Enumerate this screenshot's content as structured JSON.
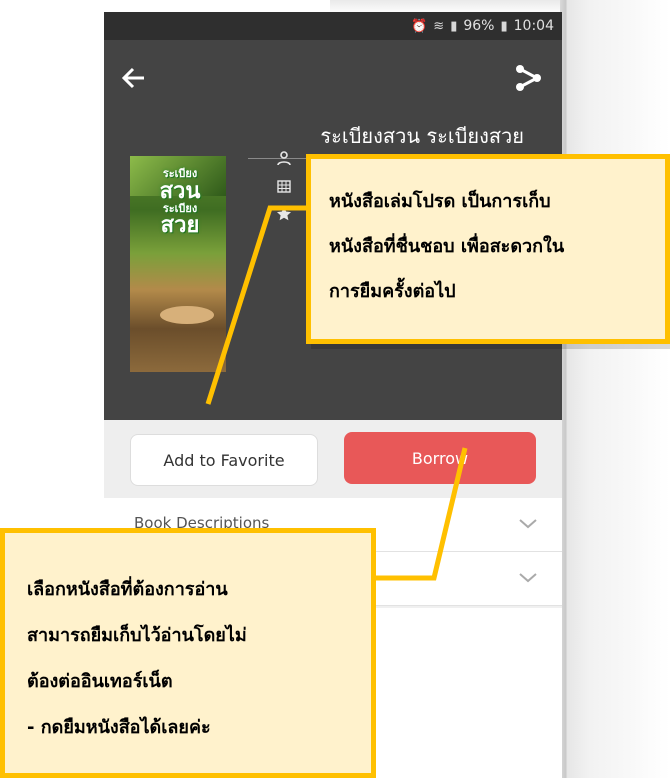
{
  "status_bar": {
    "battery": "96%",
    "time": "10:04"
  },
  "header": {
    "book_title": "ระเบียงสวน ระเบียงสวย"
  },
  "cover": {
    "title_lines": [
      "ระเบียง",
      "สวน",
      "ระเบียง",
      "สวย"
    ]
  },
  "meta_icons": [
    "person-icon",
    "building-icon",
    "star-icon"
  ],
  "actions": {
    "favorite_label": "Add to Favorite",
    "borrow_label": "Borrow"
  },
  "sections": [
    {
      "label": "Book Descriptions"
    },
    {
      "label": ""
    }
  ],
  "callouts": {
    "favorite": [
      "หนังสือเล่มโปรด เป็นการเก็บ",
      "หนังสือที่ชื่นชอบ เพื่อสะดวกใน",
      "การยืมครั้งต่อไป"
    ],
    "borrow": [
      "เลือกหนังสือที่ต้องการอ่าน",
      "สามารถยืมเก็บไว้อ่านโดยไม่",
      "ต้องต่ออินเทอร์เน็ต",
      "- กดยืมหนังสือได้เลยค่ะ"
    ]
  },
  "colors": {
    "header_bg": "#444444",
    "borrow": "#e85858",
    "callout_fill": "#fff2cc",
    "callout_border": "#ffc000"
  }
}
